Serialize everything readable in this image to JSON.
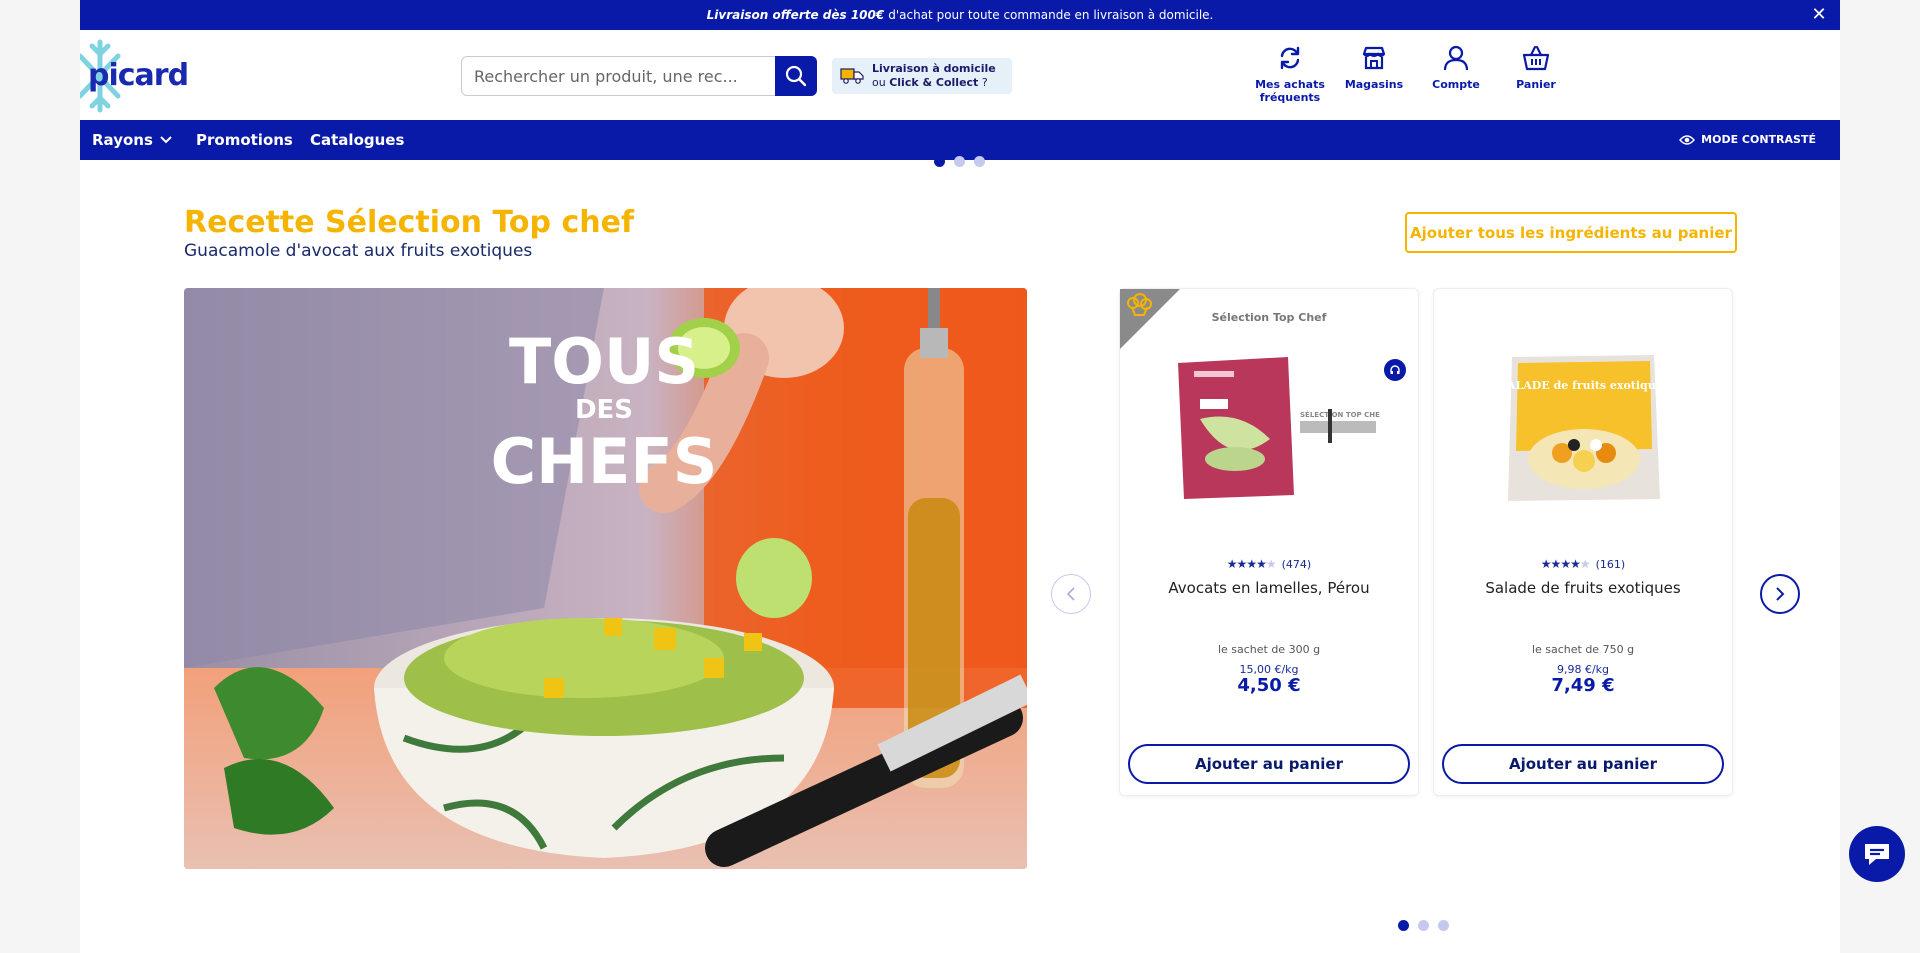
{
  "banner": {
    "bold_text": "Livraison offerte dès 100€",
    "text": "d'achat pour toute commande en livraison à domicile.",
    "close_symbol": "✕"
  },
  "header": {
    "logo_text": "picard",
    "search_placeholder": "Rechercher un produit, une rec...",
    "delivery_line1": "Livraison à domicile",
    "delivery_or": "ou",
    "delivery_collect": "Click & Collect",
    "delivery_q": "?",
    "nav": [
      {
        "label_line1": "Mes achats",
        "label_line2": "fréquents",
        "icon": "refresh-icon"
      },
      {
        "label_line1": "Magasins",
        "label_line2": "",
        "icon": "store-icon"
      },
      {
        "label_line1": "Compte",
        "label_line2": "",
        "icon": "user-icon"
      },
      {
        "label_line1": "Panier",
        "label_line2": "",
        "icon": "basket-icon"
      }
    ]
  },
  "navbar": {
    "items": [
      "Rayons",
      "Promotions",
      "Catalogues"
    ],
    "contrast_label": "MODE CONTRASTÉ"
  },
  "recipe": {
    "title": "Recette Sélection Top chef",
    "subtitle": "Guacamole d'avocat aux fruits exotiques",
    "add_all_label": "Ajouter tous les ingrédients au panier",
    "hero_text": [
      "TOUS",
      "DES",
      "CHEFS"
    ]
  },
  "products": [
    {
      "selection_label": "Sélection Top Chef",
      "rating_count": "(474)",
      "rating": 4,
      "name": "Avocats en lamelles, Pérou",
      "package": "le sachet de 300 g",
      "price_per_kg": "15,00 €/kg",
      "price": "4,50 €",
      "add_label": "Ajouter au panier",
      "logo_text": "SÉLECTION TOP CHEF"
    },
    {
      "selection_label": "",
      "rating_count": "(161)",
      "rating": 4,
      "name": "Salade de fruits exotiques",
      "package": "le sachet de 750 g",
      "price_per_kg": "9,98 €/kg",
      "price": "7,49 €",
      "add_label": "Ajouter au panier",
      "pack_text": "SALADE de fruits exotiques"
    }
  ],
  "colors": {
    "brand_blue": "#0a1aa8",
    "accent_yellow": "#f5b400"
  }
}
